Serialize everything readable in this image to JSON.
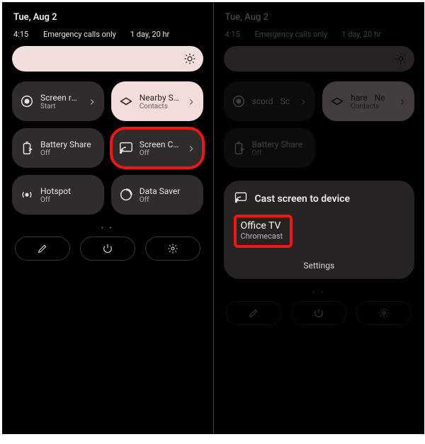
{
  "left": {
    "date": "Tue, Aug 2",
    "time": "4:15",
    "carrier": "Emergency calls only",
    "battery": "1 day, 20 hr",
    "tiles": [
      {
        "icon": "record-icon",
        "label": "Screen record",
        "sub": "Start",
        "chevron": true,
        "light": false,
        "highlight": false
      },
      {
        "icon": "nearby-icon",
        "label": "Nearby Share",
        "sub": "Contacts",
        "chevron": true,
        "light": true,
        "highlight": false
      },
      {
        "icon": "battery-share-icon",
        "label": "Battery Share",
        "sub": "Off",
        "chevron": false,
        "light": false,
        "highlight": false
      },
      {
        "icon": "cast-icon",
        "label": "Screen Cast",
        "sub": "Off",
        "chevron": true,
        "light": false,
        "highlight": true
      },
      {
        "icon": "hotspot-icon",
        "label": "Hotspot",
        "sub": "Off",
        "chevron": false,
        "light": false,
        "highlight": false
      },
      {
        "icon": "datasaver-icon",
        "label": "Data Saver",
        "sub": "Off",
        "chevron": false,
        "light": false,
        "highlight": false
      }
    ]
  },
  "right": {
    "date": "Tue, Aug 2",
    "time": "4:15",
    "carrier": "Emergency calls only",
    "battery": "1 day, 20 hr",
    "tiles": [
      {
        "icon": "record-icon",
        "frag": [
          "scord",
          "Sc"
        ],
        "chevron": true,
        "light": false
      },
      {
        "icon": "nearby-icon",
        "frag": [
          "hare",
          "Ne"
        ],
        "sub": "Contacts",
        "chevron": true,
        "light": true
      }
    ],
    "single_tile": {
      "icon": "battery-share-icon",
      "label": "Battery Share",
      "sub": "Off"
    },
    "sheet": {
      "title": "Cast screen to device",
      "device": {
        "name": "Office TV",
        "type": "Chromecast"
      },
      "settings_label": "Settings"
    }
  },
  "dots": "• •"
}
